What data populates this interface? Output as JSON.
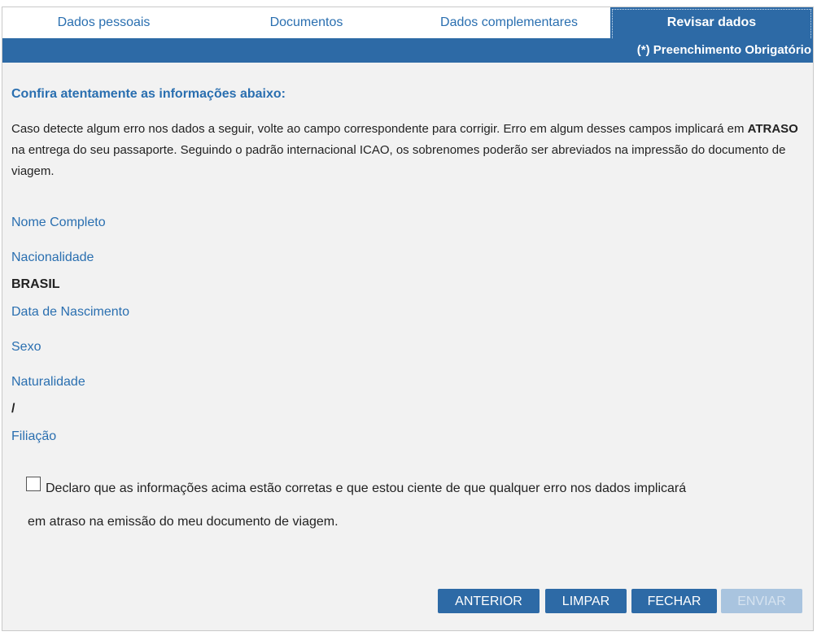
{
  "tabs": [
    {
      "label": "Dados pessoais",
      "active": false
    },
    {
      "label": "Documentos",
      "active": false
    },
    {
      "label": "Dados complementares",
      "active": false
    },
    {
      "label": "Revisar dados",
      "active": true
    }
  ],
  "required_note": "(*) Preenchimento Obrigatório",
  "heading": "Confira atentamente as informações abaixo:",
  "intro": {
    "part1": "Caso detecte algum erro nos dados a seguir, volte ao campo correspondente para corrigir. Erro em algum desses campos implicará em ",
    "emphasis": "ATRASO",
    "part2": " na entrega do seu passaporte. Seguindo o padrão internacional ICAO, os sobrenomes poderão ser abreviados na impressão do documento de viagem."
  },
  "fields": {
    "nome_label": "Nome Completo",
    "nome_value": "",
    "nacionalidade_label": "Nacionalidade",
    "nacionalidade_value": "BRASIL",
    "nascimento_label": "Data de Nascimento",
    "nascimento_value": "",
    "sexo_label": "Sexo",
    "sexo_value": "",
    "naturalidade_label": "Naturalidade",
    "naturalidade_value": "/",
    "filiacao_label": "Filiação",
    "filiacao_value": ""
  },
  "declaration": {
    "checked": false,
    "line1": "Declaro que as informações acima estão corretas e que estou ciente de que qualquer erro nos dados implicará",
    "line2": "em atraso na emissão do meu documento de viagem."
  },
  "buttons": {
    "anterior": "ANTERIOR",
    "limpar": "LIMPAR",
    "fechar": "FECHAR",
    "enviar": "ENVIAR",
    "enviar_disabled": true
  },
  "colors": {
    "primary": "#2d6aa6",
    "link_text": "#2a6fb0",
    "panel_bg": "#f2f2f2",
    "disabled_button": "#a9c4df"
  }
}
